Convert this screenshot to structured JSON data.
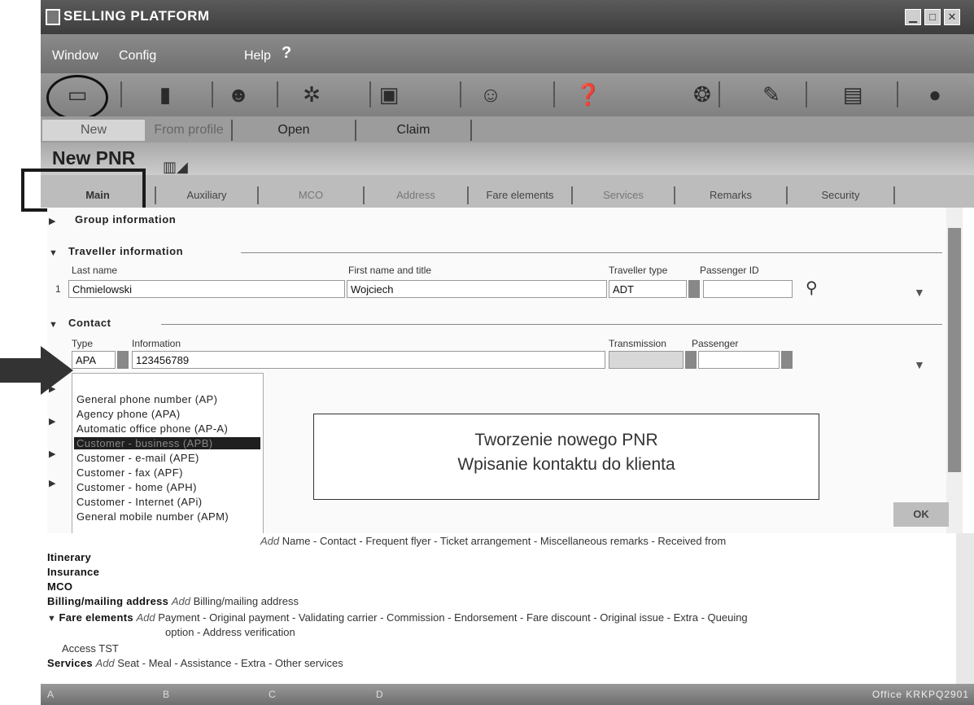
{
  "window": {
    "title": "SELLING PLATFORM",
    "buttons": [
      "▁",
      "□",
      "✕"
    ]
  },
  "menu": {
    "window": "Window",
    "config": "Config",
    "help": "Help",
    "help_mark": "?"
  },
  "toolbar_icons": [
    "book-icon",
    "document-icon",
    "person-icon",
    "hotel-icon",
    "car-icon",
    "agent-icon",
    "search-icon",
    "map-icon",
    "ticket-icon",
    "folder-icon",
    "circle-icon"
  ],
  "top_tabs": [
    "New",
    "From profile",
    "Open",
    "Claim"
  ],
  "header": {
    "title": "New PNR"
  },
  "sub_tabs": [
    "Main",
    "Auxiliary",
    "MCO",
    "Address",
    "Fare elements",
    "Services",
    "Remarks",
    "Security"
  ],
  "group_info": {
    "label": "Group information"
  },
  "traveller": {
    "label": "Traveller information",
    "col_last": "Last name",
    "col_first": "First name and title",
    "col_type": "Traveller type",
    "col_passenger": "Passenger ID",
    "row_num": "1",
    "last_name": "Chmielowski",
    "first_name": "Wojciech",
    "type": "ADT",
    "passenger_id": ""
  },
  "contact": {
    "label": "Contact",
    "col_type": "Type",
    "col_info": "Information",
    "col_transmission": "Transmission",
    "col_passenger": "Passenger",
    "type": "APA",
    "info": "123456789"
  },
  "dropdown": {
    "items": [
      "General phone number  (AP)",
      "Agency phone  (APA)",
      "Automatic office phone  (AP-A)",
      "Customer - business  (APB)",
      "Customer - e-mail  (APE)",
      "Customer - fax  (APF)",
      "Customer - home  (APH)",
      "Customer - Internet  (APi)",
      "General mobile number  (APM)"
    ],
    "selected": 3
  },
  "callout": {
    "line1": "Tworzenie nowego PNR",
    "line2": "Wpisanie kontaktu do klienta"
  },
  "ok_label": "OK",
  "summary": {
    "names_label": "Name",
    "names_add": "Add",
    "names_items": "Name - Contact - Frequent flyer - Ticket arrangement - Miscellaneous remarks - Received from",
    "itinerary": "Itinerary",
    "insurance": "Insurance",
    "mco": "MCO",
    "billing": "Billing/mailing address",
    "billing_add": "Add",
    "billing_items": "Billing/mailing address",
    "fare": "Fare elements",
    "fare_add": "Add",
    "fare_items": "Payment - Original payment - Validating carrier - Commission - Endorsement - Fare discount - Original issue - Extra - Queuing",
    "fare_items2": "option - Address verification",
    "access_tst": "Access TST",
    "services": "Services",
    "services_add": "Add",
    "services_items": "Seat - Meal - Assistance - Extra - Other services"
  },
  "status": {
    "a": "A",
    "b": "B",
    "c": "C",
    "d": "D",
    "office": "Office  KRKPQ2901"
  }
}
